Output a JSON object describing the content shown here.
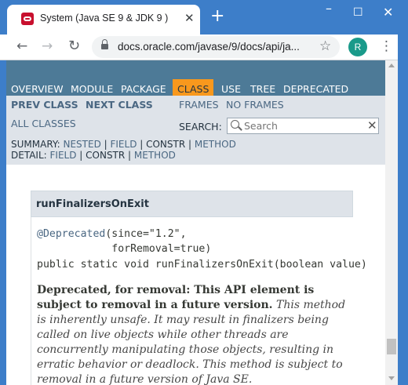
{
  "browser": {
    "tab_title": "System (Java SE 9 & JDK 9 )",
    "tab_close": "✕",
    "new_tab": "+",
    "url": "docs.oracle.com/javase/9/docs/api/ja...",
    "avatar_letter": "R",
    "window": {
      "minimize": "–",
      "maximize": "☐",
      "close": "✕"
    },
    "icons": [
      "favicon-icon",
      "back-icon",
      "forward-icon",
      "reload-icon",
      "lock-icon",
      "star-icon",
      "menu-icon"
    ]
  },
  "topnav": {
    "items": [
      "OVERVIEW",
      "MODULE",
      "PACKAGE",
      "CLASS",
      "USE",
      "TREE",
      "DEPRECATED"
    ],
    "active": "CLASS"
  },
  "subnav": {
    "prev_class": "PREV CLASS",
    "next_class": "NEXT CLASS",
    "frames": "FRAMES",
    "no_frames": "NO FRAMES",
    "all_classes": "ALL CLASSES",
    "search_label": "SEARCH:",
    "search_placeholder": "Search",
    "search_reset": "✕"
  },
  "summary": {
    "summary_label": "SUMMARY: ",
    "summary_links": [
      "NESTED",
      "FIELD",
      "CONSTR",
      "METHOD"
    ],
    "detail_label": "DETAIL: ",
    "detail_links": [
      "FIELD",
      "CONSTR",
      "METHOD"
    ],
    "separator": " | "
  },
  "member": {
    "name": "runFinalizersOnExit",
    "annotation_link": "@Deprecated",
    "annotation_line1_rest": "(since=\"1.2\",",
    "annotation_line2": "            forRemoval=true)",
    "signature": "public static void runFinalizersOnExit(boolean value)",
    "deprecation_bold": "Deprecated, for removal: This API element is subject to removal in a future version.",
    "deprecation_text": " This method is inherently unsafe. It may result in finalizers being called on live objects while other threads are concurrently manipulating those objects, resulting in erratic behavior or deadlock. This method is subject to removal in a future version of Java SE."
  },
  "colors": {
    "chrome_blue": "#3d7ec9",
    "nav_bg": "#4d7a97",
    "nav_active": "#f8981d",
    "subnav_bg": "#dee3e9",
    "link": "#4a6782"
  }
}
